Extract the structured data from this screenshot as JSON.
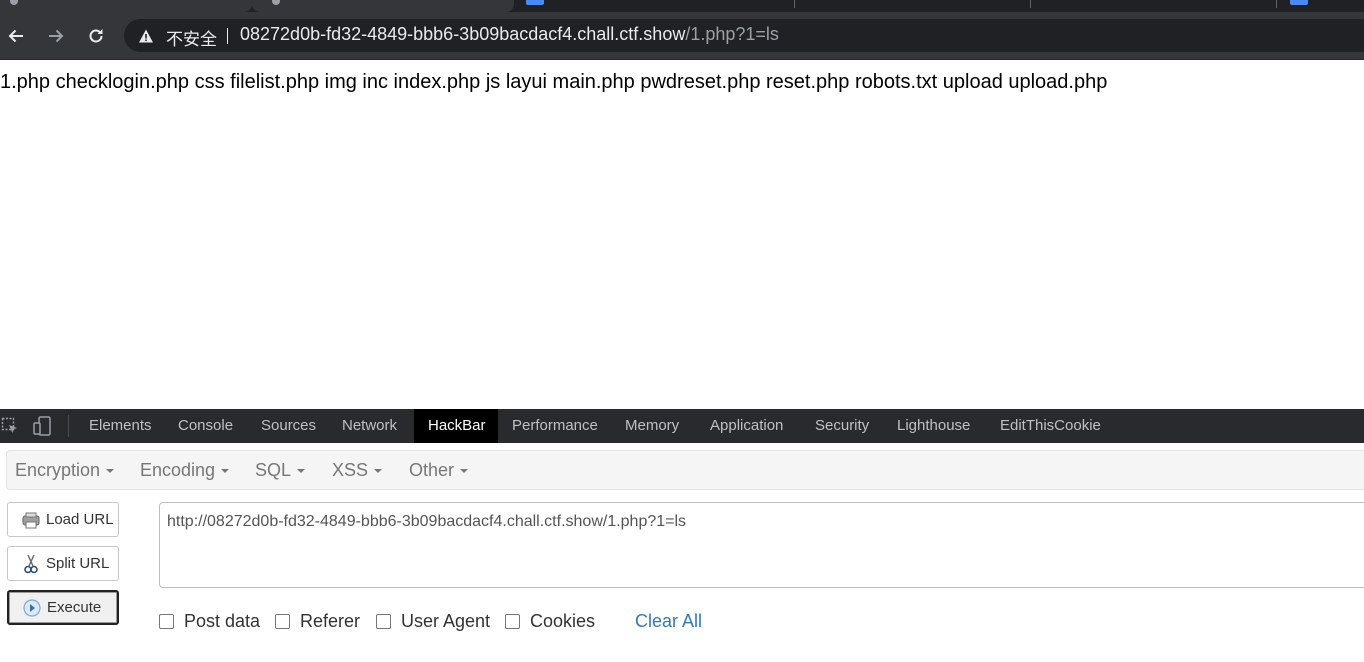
{
  "browser": {
    "security_label": "不安全",
    "url_host": "08272d0b-fd32-4849-bbb6-3b09bacdacf4.chall.ctf.show",
    "url_path": "/1.php?1=ls",
    "icons": {
      "back": "arrow-left-icon",
      "forward": "arrow-right-icon",
      "reload": "reload-icon",
      "warning": "warning-triangle-icon"
    }
  },
  "page": {
    "output": "1.php checklogin.php css filelist.php img inc index.php js layui main.php pwdreset.php reset.php robots.txt upload upload.php"
  },
  "devtools": {
    "tabs": [
      "Elements",
      "Console",
      "Sources",
      "Network",
      "HackBar",
      "Performance",
      "Memory",
      "Application",
      "Security",
      "Lighthouse",
      "EditThisCookie"
    ],
    "active_tab": "HackBar"
  },
  "hackbar": {
    "menu": [
      "Encryption",
      "Encoding",
      "SQL",
      "XSS",
      "Other"
    ],
    "buttons": {
      "load_url": "Load URL",
      "split_url": "Split URL",
      "execute": "Execute"
    },
    "url_value": "http://08272d0b-fd32-4849-bbb6-3b09bacdacf4.chall.ctf.show/1.php?1=ls",
    "options": {
      "post_data": "Post data",
      "referer": "Referer",
      "user_agent": "User Agent",
      "cookies": "Cookies"
    },
    "clear_all": "Clear All",
    "link_color": "#337ab7"
  }
}
